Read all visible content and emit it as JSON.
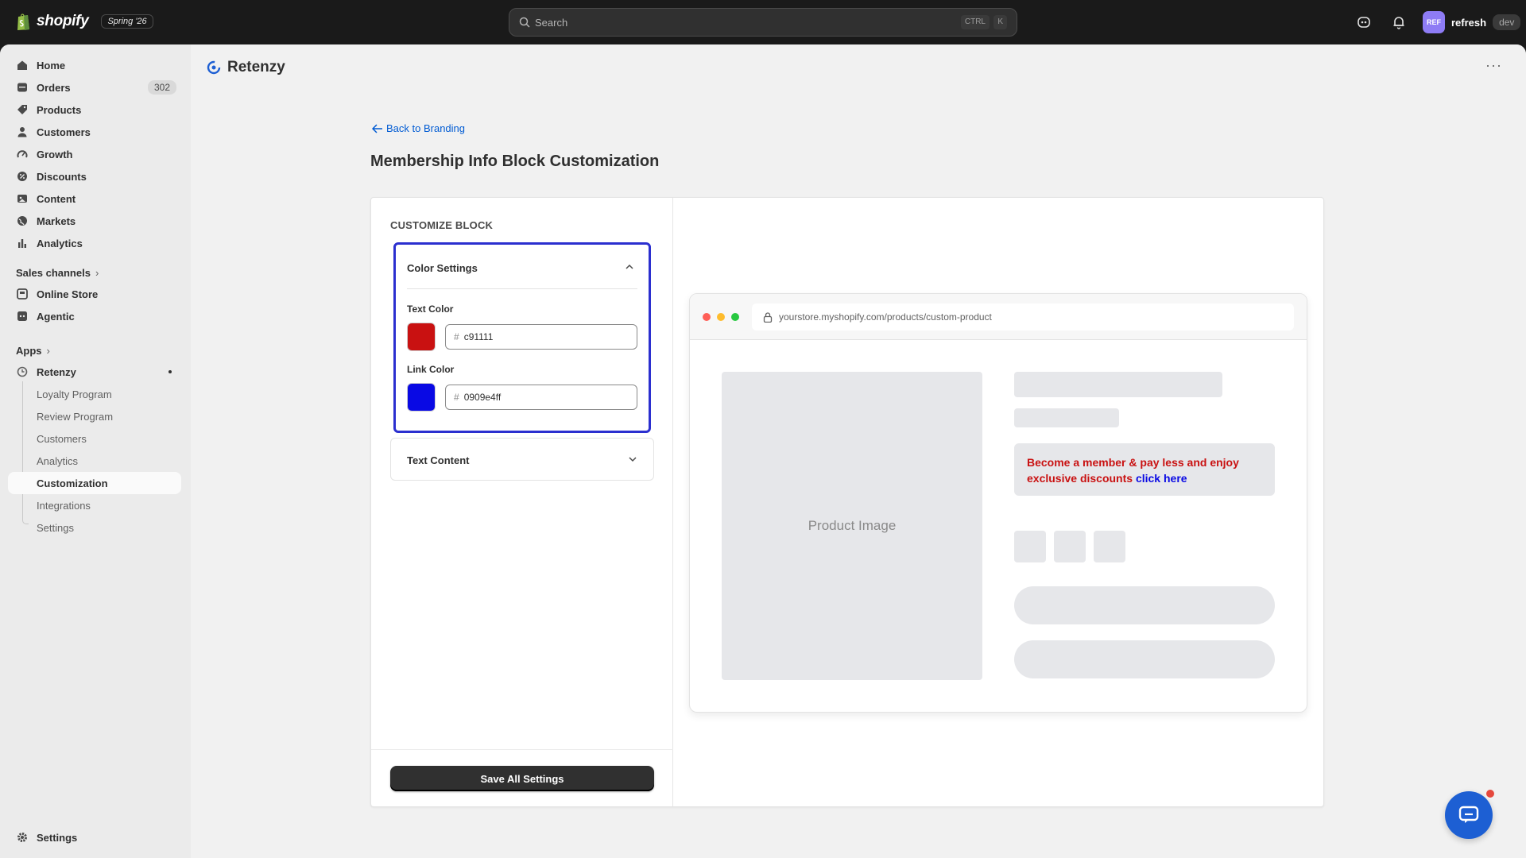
{
  "topbar": {
    "brand": "shopify",
    "edition": "Spring '26",
    "search_placeholder": "Search",
    "shortcut_ctrl": "CTRL",
    "shortcut_k": "K",
    "avatar_initials": "REF",
    "user_name": "refresh",
    "user_env": "dev"
  },
  "sidebar": {
    "items": [
      {
        "label": "Home",
        "icon": "home-icon"
      },
      {
        "label": "Orders",
        "icon": "orders-icon",
        "badge": "302"
      },
      {
        "label": "Products",
        "icon": "tag-icon"
      },
      {
        "label": "Customers",
        "icon": "person-icon"
      },
      {
        "label": "Growth",
        "icon": "gauge-icon"
      },
      {
        "label": "Discounts",
        "icon": "discount-icon"
      },
      {
        "label": "Content",
        "icon": "content-icon"
      },
      {
        "label": "Markets",
        "icon": "globe-icon"
      },
      {
        "label": "Analytics",
        "icon": "chart-icon"
      }
    ],
    "sales_channels_label": "Sales channels",
    "channels": [
      {
        "label": "Online Store",
        "icon": "store-icon"
      },
      {
        "label": "Agentic",
        "icon": "agentic-icon"
      }
    ],
    "apps_label": "Apps",
    "app": {
      "label": "Retenzy",
      "sub_items": [
        "Loyalty Program",
        "Review Program",
        "Customers",
        "Analytics",
        "Customization",
        "Integrations",
        "Settings"
      ],
      "active_sub_item": "Customization"
    },
    "settings_label": "Settings"
  },
  "main": {
    "app_title": "Retenzy",
    "more_label": "···",
    "back_link": "Back to Branding",
    "page_title": "Membership Info Block Customization",
    "customize_label": "CUSTOMIZE BLOCK",
    "color_settings": {
      "title": "Color Settings",
      "text_color_label": "Text Color",
      "text_color_value": "c91111",
      "text_color_swatch": "#c91111",
      "link_color_label": "Link Color",
      "link_color_value": "0909e4ff",
      "link_color_swatch": "#0909e4"
    },
    "text_content_title": "Text Content",
    "save_button": "Save All Settings",
    "preview": {
      "url": "yourstore.myshopify.com/products/custom-product",
      "product_image_label": "Product Image",
      "member_text": "Become a member & pay less and enjoy exclusive discounts",
      "member_link": "click here"
    }
  },
  "colors": {
    "topbar_bg": "#1a1a1a",
    "accent_border": "#2b2fcf",
    "link_blue": "#005bd3",
    "chat_button": "#1d5fd3"
  }
}
